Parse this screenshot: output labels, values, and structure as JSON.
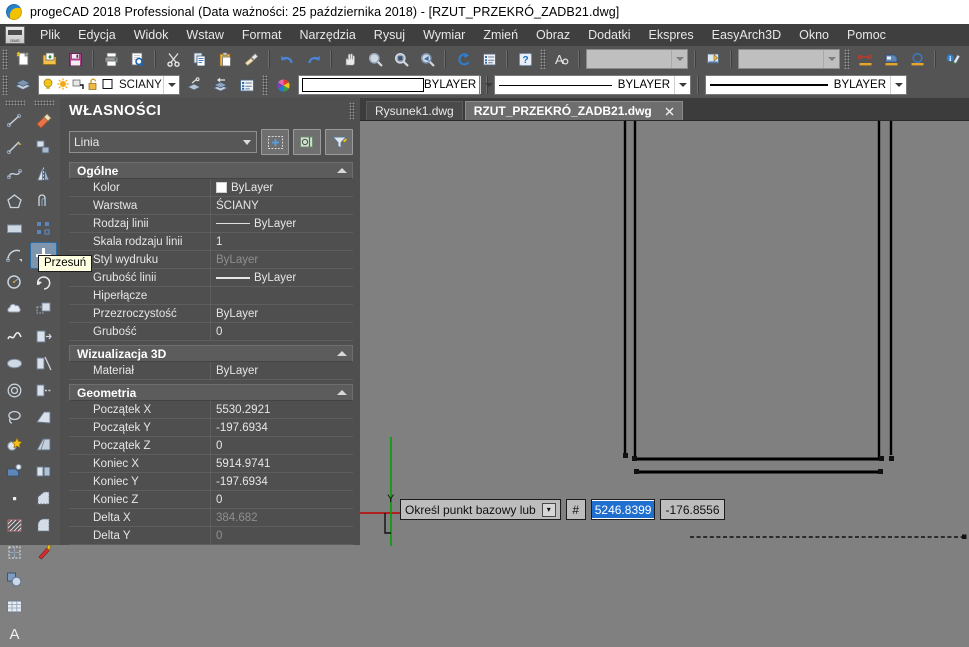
{
  "window": {
    "title": "progeCAD 2018 Professional  (Data ważności: 25 października 2018) - [RZUT_PRZEKRÓ_ZADB21.dwg]",
    "logo_icon": "progecad-logo-icon"
  },
  "menubar": {
    "app_icon": "dwg-document-icon",
    "items": [
      {
        "label": "Plik"
      },
      {
        "label": "Edycja"
      },
      {
        "label": "Widok"
      },
      {
        "label": "Wstaw"
      },
      {
        "label": "Format"
      },
      {
        "label": "Narzędzia"
      },
      {
        "label": "Rysuj"
      },
      {
        "label": "Wymiar"
      },
      {
        "label": "Zmień"
      },
      {
        "label": "Obraz"
      },
      {
        "label": "Dodatki"
      },
      {
        "label": "Ekspres"
      },
      {
        "label": "EasyArch3D"
      },
      {
        "label": "Okno"
      },
      {
        "label": "Pomoc"
      }
    ]
  },
  "toolbar_standard": {
    "buttons": [
      {
        "name": "new-file-icon",
        "tip": "Nowy"
      },
      {
        "name": "open-file-icon",
        "tip": "Otwórz"
      },
      {
        "name": "save-file-icon",
        "tip": "Zapisz"
      },
      {
        "name": "print-icon",
        "tip": "Drukuj"
      },
      {
        "name": "print-preview-icon",
        "tip": "Podgląd wydruku"
      },
      {
        "name": "cut-scissors-icon",
        "tip": "Wytnij"
      },
      {
        "name": "copy-icon",
        "tip": "Kopiuj"
      },
      {
        "name": "paste-icon",
        "tip": "Wklej"
      },
      {
        "name": "match-properties-icon",
        "tip": "Malarz formatów"
      },
      {
        "name": "undo-icon",
        "tip": "Cofnij"
      },
      {
        "name": "redo-icon",
        "tip": "Ponów"
      },
      {
        "name": "pan-hand-icon",
        "tip": "Przesuń widok"
      },
      {
        "name": "zoom-window-icon",
        "tip": "Powiększ okno"
      },
      {
        "name": "zoom-extents-icon",
        "tip": "Zoom zakres"
      },
      {
        "name": "zoom-previous-icon",
        "tip": "Poprzedni widok"
      },
      {
        "name": "refresh-regen-icon",
        "tip": "Regeneruj"
      },
      {
        "name": "properties-list-icon",
        "tip": "Właściwości"
      },
      {
        "name": "help-question-icon",
        "tip": "Pomoc"
      }
    ],
    "text_style_icon": "text-style-icon",
    "style_combo_value": "",
    "dim_style_icon": "dimension-style-icon",
    "dim_combo_value": "",
    "extra_buttons": [
      {
        "name": "point-style-icon"
      },
      {
        "name": "block-insert-icon"
      },
      {
        "name": "circle-tool-icon"
      },
      {
        "name": "info-layer-icon"
      },
      {
        "name": "add-cross-icon"
      },
      {
        "name": "render-view-icon"
      },
      {
        "name": "select-similar-icon"
      }
    ]
  },
  "toolbar_layers": {
    "layer_tools_icon": "layer-stack-icon",
    "layer_icons": [
      {
        "name": "lightbulb-on-icon"
      },
      {
        "name": "sun-freeze-icon"
      },
      {
        "name": "freeze-viewport-icon"
      },
      {
        "name": "unlock-padlock-icon"
      },
      {
        "name": "layer-color-swatch-icon"
      }
    ],
    "current_layer": "ŚCIANY",
    "after_buttons": [
      {
        "name": "make-object-layer-current-icon"
      },
      {
        "name": "layer-previous-icon"
      },
      {
        "name": "layer-manager-icon"
      }
    ],
    "color_wheel_icon": "color-wheel-icon",
    "color_value": "BYLAYER",
    "linetype_value": "BYLAYER",
    "lineweight_value": "BYLAYER"
  },
  "left_toolbar_draw": {
    "title": "Rysuj",
    "buttons": [
      {
        "name": "line-tool-icon"
      },
      {
        "name": "ray-tool-icon"
      },
      {
        "name": "spline-tool-icon"
      },
      {
        "name": "polygon-tool-icon"
      },
      {
        "name": "rectangle-tool-icon"
      },
      {
        "name": "arc-tool-icon"
      },
      {
        "name": "circle-tool-icon"
      },
      {
        "name": "cloud-revision-icon"
      },
      {
        "name": "freehand-sketch-icon"
      },
      {
        "name": "ellipse-tool-icon"
      },
      {
        "name": "donut-tool-icon"
      },
      {
        "name": "lasso-select-icon"
      },
      {
        "name": "block-insert-tool-icon"
      },
      {
        "name": "block-edit-icon"
      },
      {
        "name": "point-tool-icon"
      },
      {
        "name": "hatch-tool-icon"
      },
      {
        "name": "gradient-tool-icon"
      },
      {
        "name": "region-tool-icon"
      },
      {
        "name": "table-tool-icon"
      },
      {
        "name": "text-tool-icon"
      }
    ]
  },
  "left_toolbar_modify": {
    "title": "Zmień",
    "buttons": [
      {
        "name": "erase-tool-icon"
      },
      {
        "name": "copy-object-icon"
      },
      {
        "name": "mirror-tool-icon"
      },
      {
        "name": "offset-tool-icon"
      },
      {
        "name": "array-tool-icon"
      },
      {
        "name": "move-tool-icon",
        "active": true,
        "tooltip": "Przesuń"
      },
      {
        "name": "rotate-tool-icon"
      },
      {
        "name": "scale-tool-icon"
      },
      {
        "name": "stretch-tool-icon"
      },
      {
        "name": "trim-tool-icon"
      },
      {
        "name": "extend-tool-icon"
      },
      {
        "name": "break-at-point-icon"
      },
      {
        "name": "break-tool-icon"
      },
      {
        "name": "join-tool-icon"
      },
      {
        "name": "chamfer-tool-icon"
      },
      {
        "name": "fillet-tool-icon"
      },
      {
        "name": "explode-tool-icon"
      }
    ]
  },
  "tooltip": {
    "text": "Przesuń"
  },
  "properties_panel": {
    "title": "WŁASNOŚCI",
    "object_type": "Linia",
    "header_buttons": [
      {
        "name": "quick-select-icon"
      },
      {
        "name": "pick-add-icon"
      },
      {
        "name": "filter-funnel-icon"
      }
    ],
    "categories": [
      {
        "name": "Ogólne",
        "collapse_icon": "collapse-triangle-icon",
        "rows": [
          {
            "label": "Kolor",
            "value": "ByLayer",
            "kind": "color",
            "grayed": false
          },
          {
            "label": "Warstwa",
            "value": "ŚCIANY",
            "kind": "text",
            "grayed": false
          },
          {
            "label": "Rodzaj linii",
            "value": "ByLayer",
            "kind": "linetype",
            "grayed": false
          },
          {
            "label": "Skala rodzaju linii",
            "value": "1",
            "kind": "text",
            "grayed": false
          },
          {
            "label": "Styl wydruku",
            "value": "ByLayer",
            "kind": "text",
            "grayed": true
          },
          {
            "label": "Grubość linii",
            "value": "ByLayer",
            "kind": "lineweight",
            "grayed": false
          },
          {
            "label": "Hiperłącze",
            "value": "",
            "kind": "text",
            "grayed": false
          },
          {
            "label": "Przezroczystość",
            "value": "ByLayer",
            "kind": "text",
            "grayed": false
          },
          {
            "label": "Grubość",
            "value": "0",
            "kind": "text",
            "grayed": false
          }
        ]
      },
      {
        "name": "Wizualizacja 3D",
        "collapse_icon": "collapse-triangle-icon",
        "rows": [
          {
            "label": "Materiał",
            "value": "ByLayer",
            "kind": "text",
            "grayed": false
          }
        ]
      },
      {
        "name": "Geometria",
        "collapse_icon": "collapse-triangle-icon",
        "rows": [
          {
            "label": "Początek X",
            "value": "5530.2921",
            "kind": "text",
            "grayed": false
          },
          {
            "label": "Początek Y",
            "value": "-197.6934",
            "kind": "text",
            "grayed": false
          },
          {
            "label": "Początek Z",
            "value": "0",
            "kind": "text",
            "grayed": false
          },
          {
            "label": "Koniec X",
            "value": "5914.9741",
            "kind": "text",
            "grayed": false
          },
          {
            "label": "Koniec Y",
            "value": "-197.6934",
            "kind": "text",
            "grayed": false
          },
          {
            "label": "Koniec Z",
            "value": "0",
            "kind": "text",
            "grayed": false
          },
          {
            "label": "Delta X",
            "value": "384.682",
            "kind": "text",
            "grayed": true
          },
          {
            "label": "Delta Y",
            "value": "0",
            "kind": "text",
            "grayed": true
          }
        ]
      }
    ]
  },
  "document_tabs": [
    {
      "label": "Rysunek1.dwg",
      "active": false,
      "closable": false
    },
    {
      "label": "RZUT_PRZEKRÓ_ZADB21.dwg",
      "active": true,
      "closable": true,
      "close_icon": "close-x-icon"
    }
  ],
  "canvas": {
    "background_color": "#808080",
    "entity_color": "#000000",
    "ucs": {
      "x_axis_color": "#c00000",
      "y_axis_color": "#00a000",
      "y_label": "Y"
    },
    "tracking_line": "dashed-polar-tracking-line"
  },
  "dynamic_input": {
    "prompt": "Określ punkt bazowy lub",
    "expand_icon": "dropdown-expand-icon",
    "hash_symbol": "#",
    "x_value": "5246.8399",
    "y_value": "-176.8556",
    "highlight_color": "#1f6fd0"
  }
}
